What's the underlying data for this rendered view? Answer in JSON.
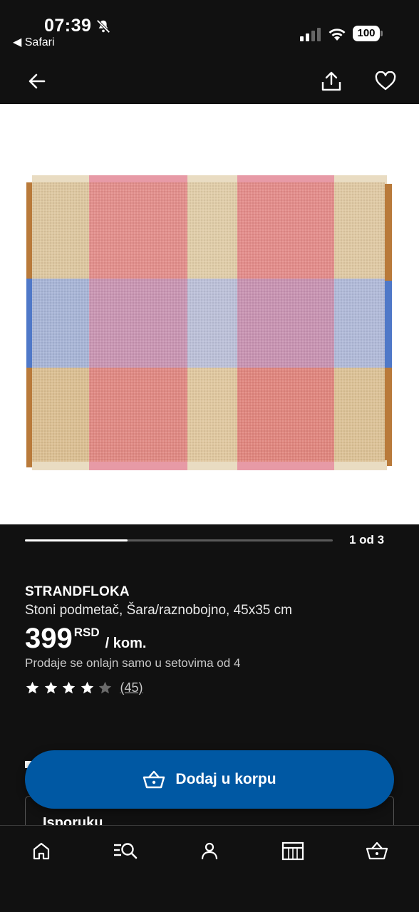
{
  "status_bar": {
    "time": "07:39",
    "back_app": "◀ Safari",
    "battery": "100",
    "icons": [
      "bell-off-icon",
      "signal-icon",
      "wifi-icon",
      "battery-icon"
    ]
  },
  "nav": {
    "icons": [
      "back-arrow-icon",
      "share-icon",
      "heart-icon"
    ]
  },
  "gallery": {
    "counter": "1 od 3",
    "current": 1,
    "total": 3,
    "image_description_icon": "placemat-image"
  },
  "product": {
    "name": "STRANDFLOKA",
    "description": "Stoni podmetač, Šara/raznobojno, 45x35 cm",
    "price": "399",
    "currency": "RSD",
    "unit": "/ kom.",
    "set_note": "Prodaje se onlajn samo u setovima od 4",
    "rating": 4,
    "rating_max": 5,
    "review_count": "(45)"
  },
  "actions": {
    "add_to_cart": "Dodaj u korpu",
    "accent_color": "#0058a3"
  },
  "delivery": {
    "label": "Isporuku"
  },
  "tab_bar": {
    "tabs": [
      "home-icon",
      "search-icon",
      "profile-icon",
      "store-icon",
      "cart-icon"
    ]
  }
}
